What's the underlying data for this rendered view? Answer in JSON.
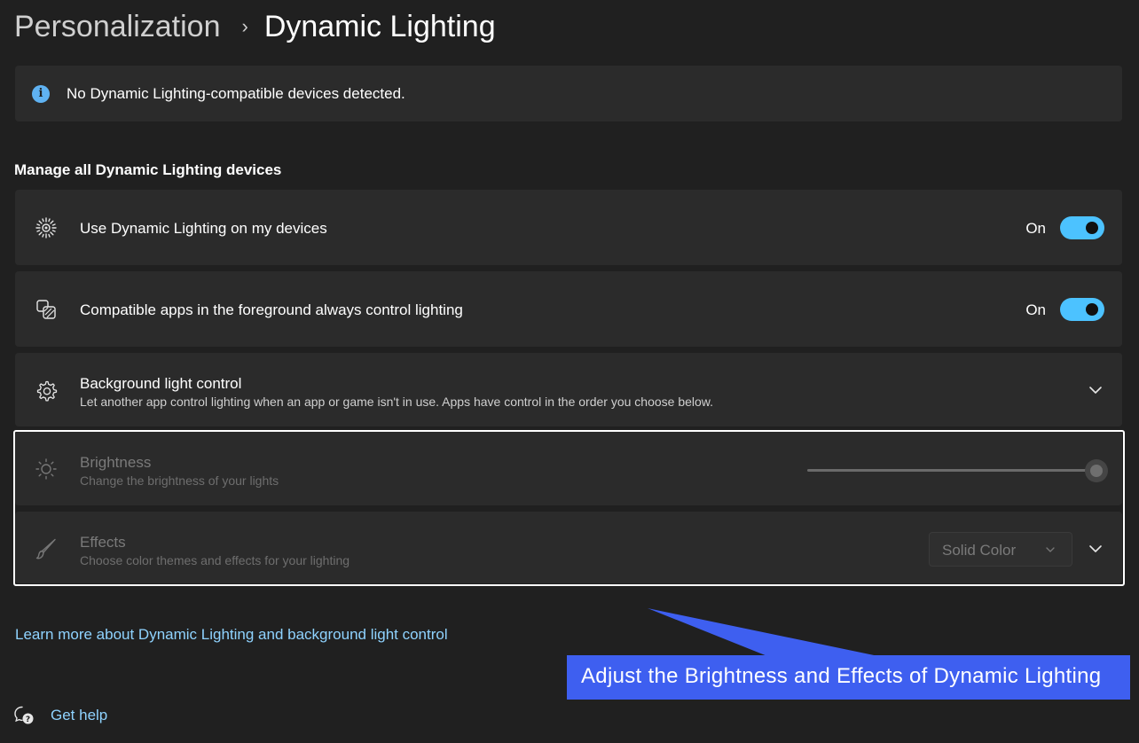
{
  "breadcrumb": {
    "parent": "Personalization",
    "separator": "›",
    "current": "Dynamic Lighting"
  },
  "info_bar": {
    "icon": "info-icon",
    "text": "No Dynamic Lighting-compatible devices detected."
  },
  "section_title": "Manage all Dynamic Lighting devices",
  "settings": {
    "use_dynamic_lighting": {
      "icon": "dynamic-lighting-icon",
      "label": "Use Dynamic Lighting on my devices",
      "state_text": "On",
      "value": true
    },
    "foreground_apps": {
      "icon": "apps-layers-icon",
      "label": "Compatible apps in the foreground always control lighting",
      "state_text": "On",
      "value": true
    },
    "background_light_control": {
      "icon": "gear-icon",
      "title": "Background light control",
      "description": "Let another app control lighting when an app or game isn't in use. Apps have control in the order you choose below."
    },
    "brightness": {
      "icon": "sun-icon",
      "title": "Brightness",
      "description": "Change the brightness of your lights",
      "value_fraction": 1.0
    },
    "effects": {
      "icon": "brush-icon",
      "title": "Effects",
      "description": "Choose color themes and effects for your lighting",
      "selected": "Solid Color"
    }
  },
  "link_text": "Learn more about Dynamic Lighting and background light control",
  "help": {
    "icon": "help-chat-icon",
    "text": "Get help"
  },
  "callout": {
    "text": "Adjust the Brightness and Effects of Dynamic Lighting",
    "color": "#3e5ff0"
  },
  "colors": {
    "background": "#202020",
    "card": "#2b2b2b",
    "accent": "#4cc2ff",
    "link": "#8fd3ff"
  }
}
